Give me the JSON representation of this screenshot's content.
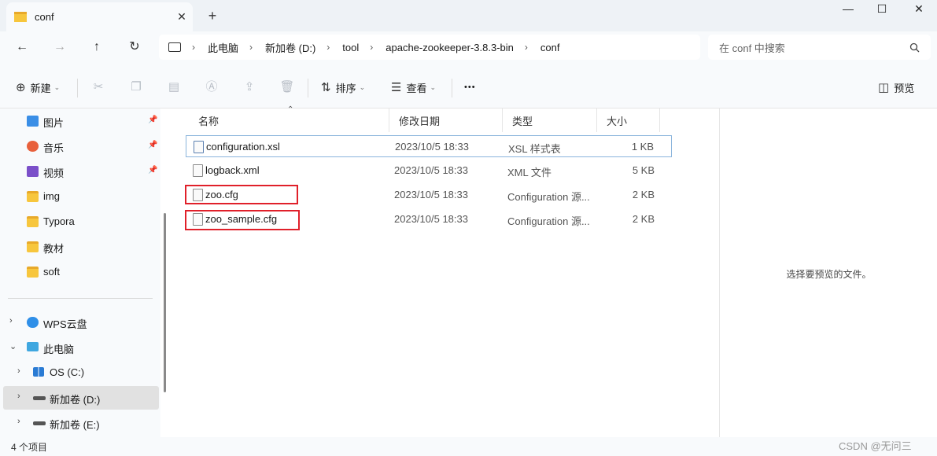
{
  "window": {
    "tab_title": "conf",
    "new_tab": "+",
    "close_tab": "✕",
    "minimize": "—",
    "maximize": "☐",
    "close": "✕"
  },
  "nav": {
    "back": "←",
    "forward": "→",
    "up": "↑",
    "refresh": "↻"
  },
  "breadcrumb": [
    "此电脑",
    "新加卷 (D:)",
    "tool",
    "apache-zookeeper-3.8.3-bin",
    "conf"
  ],
  "search": {
    "placeholder": "在 conf 中搜索"
  },
  "toolbar": {
    "new_label": "新建",
    "sort_label": "排序",
    "view_label": "查看",
    "more_label": "•••",
    "preview_label": "预览"
  },
  "sidebar": {
    "quick_items": [
      {
        "label": "图片",
        "icon": "pictures-icon",
        "pinned": true
      },
      {
        "label": "音乐",
        "icon": "music-icon",
        "pinned": true
      },
      {
        "label": "视频",
        "icon": "videos-icon",
        "pinned": true
      },
      {
        "label": "img",
        "icon": "folder-icon",
        "pinned": false
      },
      {
        "label": "Typora",
        "icon": "folder-icon",
        "pinned": false
      },
      {
        "label": "教材",
        "icon": "folder-icon",
        "pinned": false
      },
      {
        "label": "soft",
        "icon": "folder-icon",
        "pinned": false
      }
    ],
    "tree_items": [
      {
        "label": "WPS云盘",
        "icon": "cloud-icon",
        "expander": "›"
      },
      {
        "label": "此电脑",
        "icon": "this-pc-icon",
        "expander": "⌄"
      },
      {
        "label": "OS (C:)",
        "icon": "windows-drive-icon",
        "expander": "›"
      },
      {
        "label": "新加卷 (D:)",
        "icon": "drive-icon",
        "expander": "›",
        "selected": true
      },
      {
        "label": "新加卷 (E:)",
        "icon": "drive-icon",
        "expander": "›"
      }
    ]
  },
  "columns": {
    "name": "名称",
    "modified": "修改日期",
    "type": "类型",
    "size": "大小"
  },
  "files": [
    {
      "name": "configuration.xsl",
      "modified": "2023/10/5 18:33",
      "type": "XSL 样式表",
      "size": "1 KB",
      "icon": "xsl-file-icon"
    },
    {
      "name": "logback.xml",
      "modified": "2023/10/5 18:33",
      "type": "XML 文件",
      "size": "5 KB",
      "icon": "xml-file-icon"
    },
    {
      "name": "zoo.cfg",
      "modified": "2023/10/5 18:33",
      "type": "Configuration 源...",
      "size": "2 KB",
      "icon": "config-file-icon"
    },
    {
      "name": "zoo_sample.cfg",
      "modified": "2023/10/5 18:33",
      "type": "Configuration 源...",
      "size": "2 KB",
      "icon": "config-file-icon"
    }
  ],
  "preview": {
    "message": "选择要预览的文件。"
  },
  "status": {
    "item_count": "4 个项目"
  },
  "watermark": "CSDN @无问三",
  "colors": {
    "highlight_box": "#e0202a",
    "selection_border": "#8ab4dc",
    "folder": "#f7c63d"
  }
}
